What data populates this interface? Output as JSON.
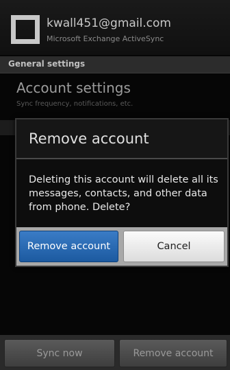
{
  "account": {
    "email": "kwall451@gmail.com",
    "type": "Microsoft Exchange ActiveSync",
    "icon": "exchange-account-icon"
  },
  "section": {
    "header": "General settings"
  },
  "account_settings": {
    "title": "Account settings",
    "summary": "Sync frequency, notifications, etc."
  },
  "dialog": {
    "title": "Remove account",
    "message": "Deleting this account will delete all its messages, contacts, and other data from phone. Delete?",
    "confirm_label": "Remove account",
    "cancel_label": "Cancel"
  },
  "bottom_bar": {
    "sync_label": "Sync now",
    "remove_label": "Remove account"
  },
  "colors": {
    "accent": "#2a6bb5",
    "background": "#060606"
  }
}
